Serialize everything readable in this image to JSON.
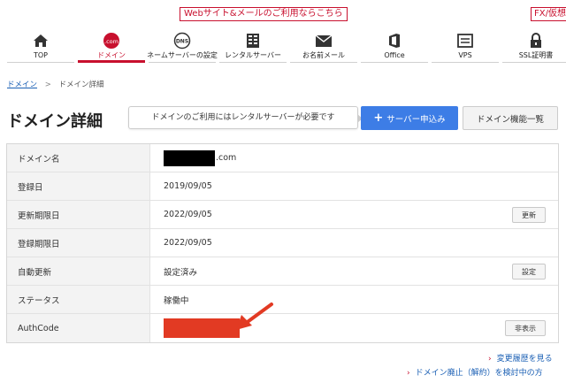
{
  "banner": {
    "text": "Webサイト&メールのご利用ならこちら",
    "fx": "FX/仮想"
  },
  "nav": {
    "items": [
      {
        "label": "TOP",
        "icon": "home-icon"
      },
      {
        "label": "ドメイン",
        "icon": "com-icon",
        "active": true
      },
      {
        "label": "ネームサーバーの設定",
        "icon": "dns-icon"
      },
      {
        "label": "レンタルサーバー",
        "icon": "server-icon"
      },
      {
        "label": "お名前メール",
        "icon": "mail-icon"
      },
      {
        "label": "Office",
        "icon": "office-icon"
      },
      {
        "label": "VPS",
        "icon": "vps-icon"
      },
      {
        "label": "SSL証明書",
        "icon": "lock-icon"
      }
    ]
  },
  "breadcrumb": {
    "root": "ドメイン",
    "separator": ">",
    "current": "ドメイン詳細"
  },
  "page": {
    "title": "ドメイン詳細",
    "notice": "ドメインのご利用にはレンタルサーバーが必要です",
    "primary_button": "サーバー申込み",
    "secondary_button": "ドメイン機能一覧"
  },
  "details": {
    "domain": {
      "label": "ドメイン名",
      "suffix": ".com"
    },
    "registered": {
      "label": "登録日",
      "value": "2019/09/05"
    },
    "renewal_deadline": {
      "label": "更新期限日",
      "value": "2022/09/05",
      "button": "更新"
    },
    "registration_deadline": {
      "label": "登録期限日",
      "value": "2022/09/05"
    },
    "auto_renew": {
      "label": "自動更新",
      "value": "設定済み",
      "button": "設定"
    },
    "status": {
      "label": "ステータス",
      "value": "稼働中"
    },
    "authcode": {
      "label": "AuthCode",
      "button": "非表示"
    }
  },
  "footer": {
    "history_link": "変更履歴を見る",
    "cancel_link": "ドメイン廃止（解約）を検討中の方"
  },
  "colors": {
    "brand_red": "#c8102e",
    "primary_blue": "#3d7de6",
    "redaction_red": "#e23a23",
    "arrow_red": "#e23a23"
  }
}
